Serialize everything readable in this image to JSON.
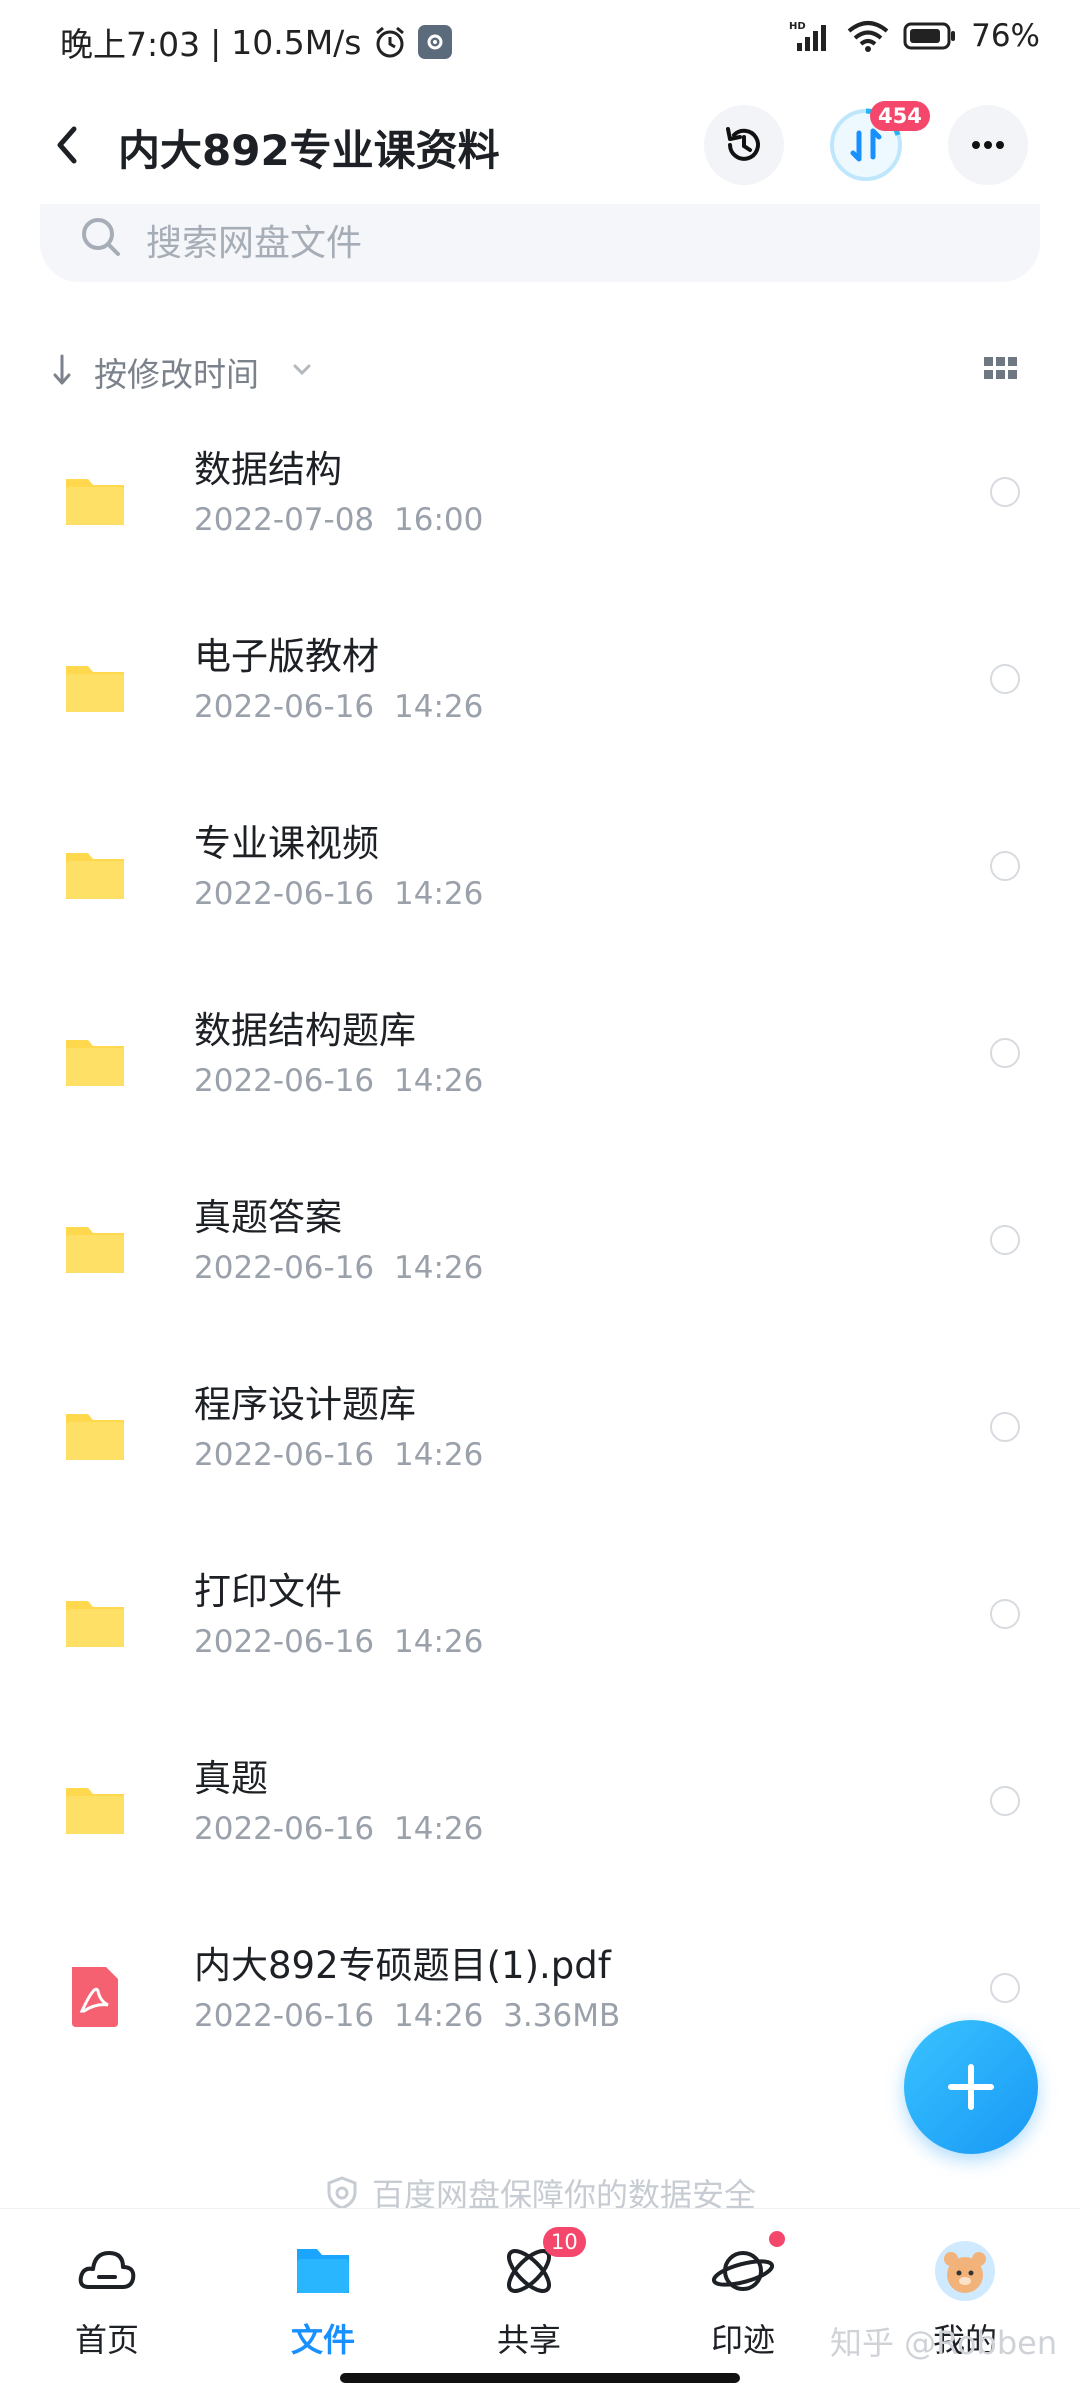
{
  "status_bar": {
    "time": "晚上7:03",
    "network_speed": "10.5M/s",
    "battery": "76%"
  },
  "header": {
    "title": "内大892专业课资料",
    "transfer_badge": "454"
  },
  "search": {
    "placeholder": "搜索网盘文件"
  },
  "sort": {
    "label": "按修改时间"
  },
  "files": [
    {
      "name": "数据结构",
      "meta": "2022-07-08 16:00",
      "type": "folder"
    },
    {
      "name": "电子版教材",
      "meta": "2022-06-16 14:26",
      "type": "folder"
    },
    {
      "name": "专业课视频",
      "meta": "2022-06-16 14:26",
      "type": "folder"
    },
    {
      "name": "数据结构题库",
      "meta": "2022-06-16 14:26",
      "type": "folder"
    },
    {
      "name": "真题答案",
      "meta": "2022-06-16 14:26",
      "type": "folder"
    },
    {
      "name": "程序设计题库",
      "meta": "2022-06-16 14:26",
      "type": "folder"
    },
    {
      "name": "打印文件",
      "meta": "2022-06-16 14:26",
      "type": "folder"
    },
    {
      "name": "真题",
      "meta": "2022-06-16 14:26",
      "type": "folder"
    },
    {
      "name": "内大892专硕题目(1).pdf",
      "meta": "2022-06-16 14:26 3.36MB",
      "type": "pdf"
    }
  ],
  "security_note": "百度网盘保障你的数据安全",
  "bottom_nav": {
    "items": [
      {
        "label": "首页"
      },
      {
        "label": "文件"
      },
      {
        "label": "共享",
        "badge": "10"
      },
      {
        "label": "印迹"
      },
      {
        "label": "我的"
      }
    ]
  },
  "watermark": "知乎 @Robben",
  "colors": {
    "accent": "#1890ff",
    "folder": "#ffd84d",
    "badge": "#f5476b",
    "pdf": "#f56171"
  }
}
